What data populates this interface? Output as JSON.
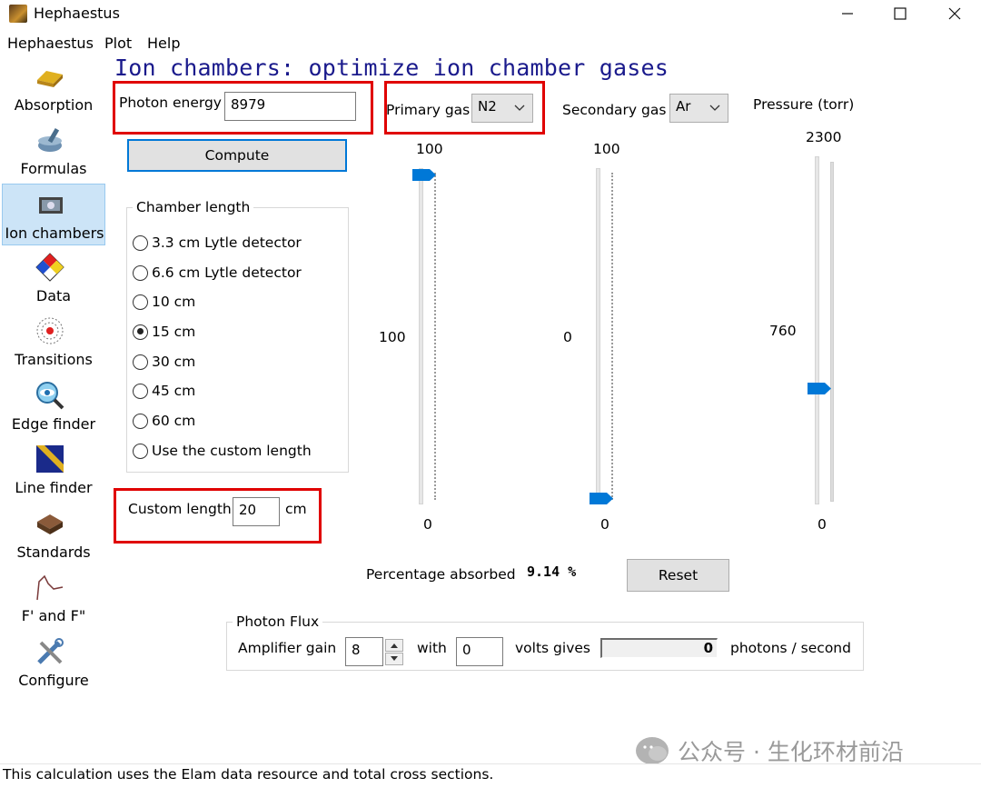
{
  "window": {
    "title": "Hephaestus"
  },
  "menu": [
    "Hephaestus",
    "Plot",
    "Help"
  ],
  "sidebar": {
    "items": [
      {
        "label": "Absorption",
        "icon": "gold-bar-icon"
      },
      {
        "label": "Formulas",
        "icon": "mortar-pestle-icon"
      },
      {
        "label": "Ion chambers",
        "icon": "ion-chamber-icon",
        "selected": true
      },
      {
        "label": "Data",
        "icon": "hazard-diamond-icon"
      },
      {
        "label": "Transitions",
        "icon": "atom-icon"
      },
      {
        "label": "Edge finder",
        "icon": "magnifier-eye-icon"
      },
      {
        "label": "Line finder",
        "icon": "ruler-icon"
      },
      {
        "label": "Standards",
        "icon": "sample-box-icon"
      },
      {
        "label": "F' and F\"",
        "icon": "curve-icon"
      },
      {
        "label": "Configure",
        "icon": "tools-icon"
      }
    ]
  },
  "heading": "Ion chambers: optimize ion chamber gases",
  "photon_energy": {
    "label": "Photon energy",
    "value": "8979"
  },
  "primary_gas": {
    "label": "Primary gas",
    "value": "N2"
  },
  "secondary_gas": {
    "label": "Secondary gas",
    "value": "Ar"
  },
  "pressure": {
    "label": "Pressure (torr)"
  },
  "compute_label": "Compute",
  "chamber_length": {
    "title": "Chamber length",
    "options": [
      "3.3 cm Lytle detector",
      "6.6 cm Lytle detector",
      "10 cm",
      "15 cm",
      "30 cm",
      "45 cm",
      "60 cm",
      "Use the custom length"
    ],
    "selected": "15 cm"
  },
  "custom_length": {
    "label": "Custom length",
    "value": "20",
    "unit": "cm"
  },
  "sliders": {
    "primary": {
      "max": "100",
      "min": "0",
      "value": "100",
      "level": 1.0
    },
    "secondary": {
      "max": "100",
      "min": "0",
      "value": "0",
      "level": 0.0
    },
    "pressure": {
      "max": "2300",
      "min": "0",
      "value": "760",
      "level": 0.33
    }
  },
  "absorbed": {
    "label": "Percentage absorbed",
    "value": "9.14 %"
  },
  "reset_label": "Reset",
  "photon_flux": {
    "title": "Photon Flux",
    "gain_label": "Amplifier gain",
    "gain_value": "8",
    "with_label": "with",
    "volts_value": "0",
    "volts_label": "volts gives",
    "photons_value": "0",
    "photons_label": "photons / second"
  },
  "status": "This calculation uses the Elam data resource and total cross sections.",
  "watermark": "公众号 · 生化环材前沿",
  "colors": {
    "heading": "#1a1a8c",
    "highlight": "#e00000",
    "thumb": "#0078d7",
    "selection": "#cce4f7"
  }
}
